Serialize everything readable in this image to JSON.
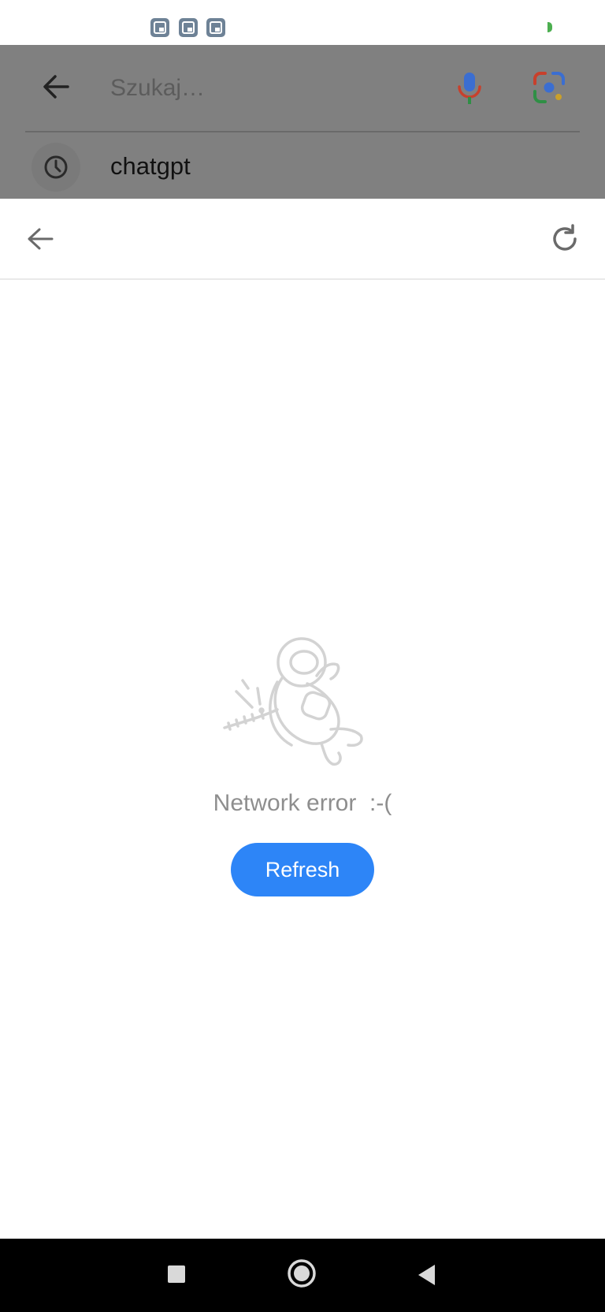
{
  "status_bar": {
    "notification_icons": [
      "gallery-icon",
      "gallery-icon",
      "gallery-icon"
    ],
    "battery_color": "#4caf50"
  },
  "search": {
    "placeholder": "Szukaj…",
    "value": "",
    "history": [
      {
        "label": "chatgpt",
        "icon": "history-clock-icon"
      }
    ],
    "overlay_color": "#808080"
  },
  "web_header": {
    "back_icon": "arrow-left-icon",
    "reload_icon": "reload-icon"
  },
  "error": {
    "illustration": "astronaut-icon",
    "message": "Network error  :-(",
    "refresh_label": "Refresh",
    "accent_color": "#2d85f7"
  },
  "nav_bar": {
    "items": [
      "recent-apps",
      "home",
      "back"
    ]
  }
}
